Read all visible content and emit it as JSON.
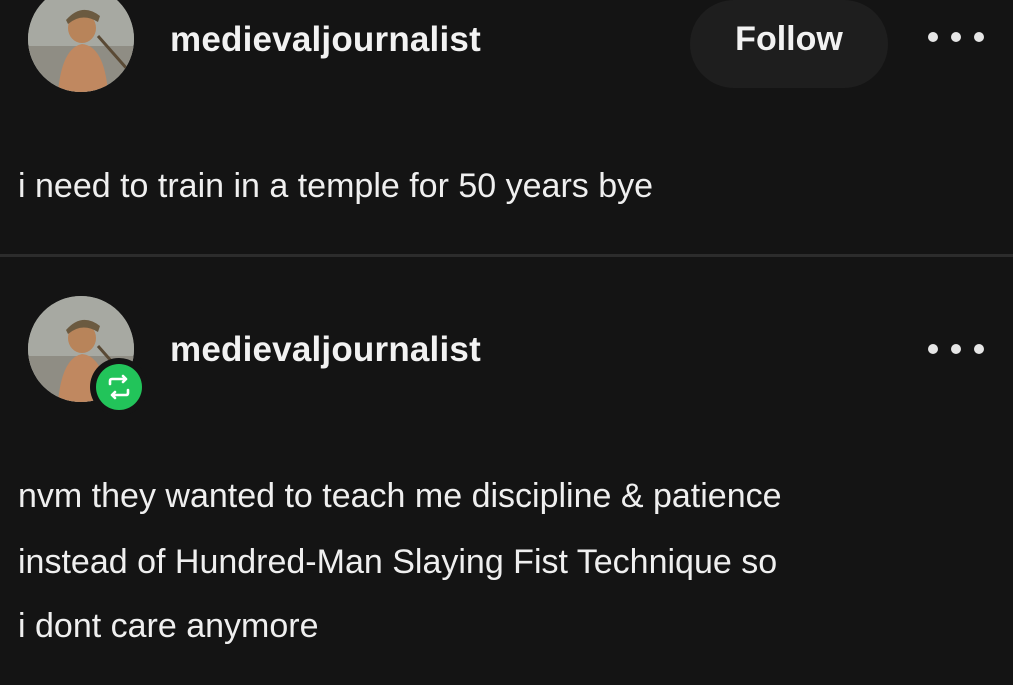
{
  "posts": [
    {
      "username": "medievaljournalist",
      "follow_label": "Follow",
      "more_icon": "more-horizontal-icon",
      "body": "i need to train in a temple for 50 years bye"
    },
    {
      "username": "medievaljournalist",
      "more_icon": "more-horizontal-icon",
      "badge_icon": "reblog-icon",
      "badge_color": "#22c45a",
      "body_lines": [
        "nvm they wanted to teach me discipline & patience",
        "instead of Hundred-Man Slaying Fist Technique so",
        "i dont care anymore"
      ]
    }
  ],
  "colors": {
    "background": "#141414",
    "text": "#efefef",
    "button_bg": "#1e1e1e",
    "reblog_green": "#22c45a"
  }
}
